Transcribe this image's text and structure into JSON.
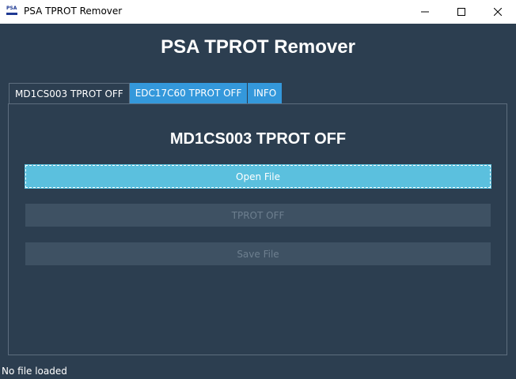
{
  "window": {
    "title": "PSA TPROT Remover",
    "icon_text": "PSA"
  },
  "app": {
    "heading": "PSA TPROT Remover"
  },
  "tabs": [
    {
      "label": "MD1CS003 TPROT OFF",
      "active": true
    },
    {
      "label": "EDC17C60 TPROT OFF",
      "active": false
    },
    {
      "label": "INFO",
      "active": false
    }
  ],
  "panel": {
    "heading": "MD1CS003 TPROT OFF",
    "buttons": {
      "open_file": "Open File",
      "tprot_off": "TPROT OFF",
      "save_file": "Save File"
    }
  },
  "status": {
    "text": "No file loaded"
  },
  "colors": {
    "background": "#2c3e50",
    "tab_accent": "#3498db",
    "open_button": "#5bc0de",
    "disabled_button": "#3e5163"
  }
}
